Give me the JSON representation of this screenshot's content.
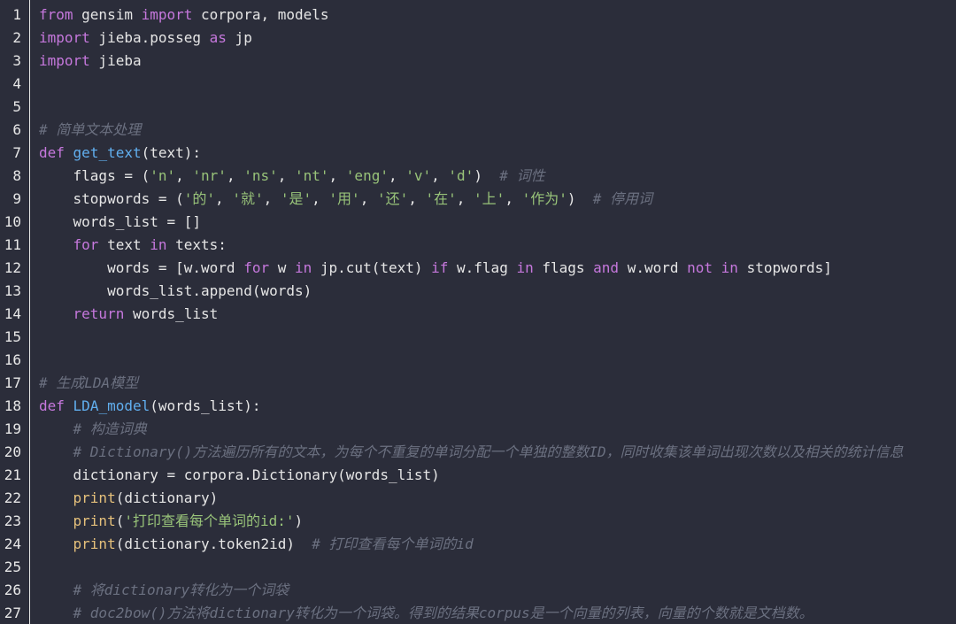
{
  "editor": {
    "colors": {
      "background": "#2b2d3a",
      "text": "#e6e6e6",
      "keyword": "#c678dd",
      "function": "#61afef",
      "builtin": "#e5c07b",
      "string": "#98c379",
      "comment": "#6b7080",
      "line_number": "#e8e8e8"
    },
    "lines": [
      {
        "n": "1",
        "tokens": [
          {
            "t": "kw",
            "s": "from"
          },
          {
            "t": "txt",
            "s": " gensim "
          },
          {
            "t": "kw",
            "s": "import"
          },
          {
            "t": "txt",
            "s": " corpora, models"
          }
        ]
      },
      {
        "n": "2",
        "tokens": [
          {
            "t": "kw",
            "s": "import"
          },
          {
            "t": "txt",
            "s": " jieba.posseg "
          },
          {
            "t": "kw",
            "s": "as"
          },
          {
            "t": "txt",
            "s": " jp"
          }
        ]
      },
      {
        "n": "3",
        "tokens": [
          {
            "t": "kw",
            "s": "import"
          },
          {
            "t": "txt",
            "s": " jieba"
          }
        ]
      },
      {
        "n": "4",
        "tokens": []
      },
      {
        "n": "5",
        "tokens": []
      },
      {
        "n": "6",
        "tokens": [
          {
            "t": "cm",
            "s": "# 简单文本处理"
          }
        ]
      },
      {
        "n": "7",
        "tokens": [
          {
            "t": "kw",
            "s": "def"
          },
          {
            "t": "txt",
            "s": " "
          },
          {
            "t": "fn",
            "s": "get_text"
          },
          {
            "t": "txt",
            "s": "(text):"
          }
        ]
      },
      {
        "n": "8",
        "tokens": [
          {
            "t": "txt",
            "s": "    flags = ("
          },
          {
            "t": "str",
            "s": "'n'"
          },
          {
            "t": "txt",
            "s": ", "
          },
          {
            "t": "str",
            "s": "'nr'"
          },
          {
            "t": "txt",
            "s": ", "
          },
          {
            "t": "str",
            "s": "'ns'"
          },
          {
            "t": "txt",
            "s": ", "
          },
          {
            "t": "str",
            "s": "'nt'"
          },
          {
            "t": "txt",
            "s": ", "
          },
          {
            "t": "str",
            "s": "'eng'"
          },
          {
            "t": "txt",
            "s": ", "
          },
          {
            "t": "str",
            "s": "'v'"
          },
          {
            "t": "txt",
            "s": ", "
          },
          {
            "t": "str",
            "s": "'d'"
          },
          {
            "t": "txt",
            "s": ")  "
          },
          {
            "t": "cm",
            "s": "# 词性"
          }
        ]
      },
      {
        "n": "9",
        "tokens": [
          {
            "t": "txt",
            "s": "    stopwords = ("
          },
          {
            "t": "str",
            "s": "'的'"
          },
          {
            "t": "txt",
            "s": ", "
          },
          {
            "t": "str",
            "s": "'就'"
          },
          {
            "t": "txt",
            "s": ", "
          },
          {
            "t": "str",
            "s": "'是'"
          },
          {
            "t": "txt",
            "s": ", "
          },
          {
            "t": "str",
            "s": "'用'"
          },
          {
            "t": "txt",
            "s": ", "
          },
          {
            "t": "str",
            "s": "'还'"
          },
          {
            "t": "txt",
            "s": ", "
          },
          {
            "t": "str",
            "s": "'在'"
          },
          {
            "t": "txt",
            "s": ", "
          },
          {
            "t": "str",
            "s": "'上'"
          },
          {
            "t": "txt",
            "s": ", "
          },
          {
            "t": "str",
            "s": "'作为'"
          },
          {
            "t": "txt",
            "s": ")  "
          },
          {
            "t": "cm",
            "s": "# 停用词"
          }
        ]
      },
      {
        "n": "10",
        "tokens": [
          {
            "t": "txt",
            "s": "    words_list = []"
          }
        ]
      },
      {
        "n": "11",
        "tokens": [
          {
            "t": "txt",
            "s": "    "
          },
          {
            "t": "kw",
            "s": "for"
          },
          {
            "t": "txt",
            "s": " text "
          },
          {
            "t": "kw",
            "s": "in"
          },
          {
            "t": "txt",
            "s": " texts:"
          }
        ]
      },
      {
        "n": "12",
        "tokens": [
          {
            "t": "txt",
            "s": "        words = [w.word "
          },
          {
            "t": "kw",
            "s": "for"
          },
          {
            "t": "txt",
            "s": " w "
          },
          {
            "t": "kw",
            "s": "in"
          },
          {
            "t": "txt",
            "s": " jp.cut(text) "
          },
          {
            "t": "kw",
            "s": "if"
          },
          {
            "t": "txt",
            "s": " w.flag "
          },
          {
            "t": "kw",
            "s": "in"
          },
          {
            "t": "txt",
            "s": " flags "
          },
          {
            "t": "kw",
            "s": "and"
          },
          {
            "t": "txt",
            "s": " w.word "
          },
          {
            "t": "kw",
            "s": "not"
          },
          {
            "t": "txt",
            "s": " "
          },
          {
            "t": "kw",
            "s": "in"
          },
          {
            "t": "txt",
            "s": " stopwords]"
          }
        ]
      },
      {
        "n": "13",
        "tokens": [
          {
            "t": "txt",
            "s": "        words_list.append(words)"
          }
        ]
      },
      {
        "n": "14",
        "tokens": [
          {
            "t": "txt",
            "s": "    "
          },
          {
            "t": "kw",
            "s": "return"
          },
          {
            "t": "txt",
            "s": " words_list"
          }
        ]
      },
      {
        "n": "15",
        "tokens": []
      },
      {
        "n": "16",
        "tokens": []
      },
      {
        "n": "17",
        "tokens": [
          {
            "t": "cm",
            "s": "# 生成LDA模型"
          }
        ]
      },
      {
        "n": "18",
        "tokens": [
          {
            "t": "kw",
            "s": "def"
          },
          {
            "t": "txt",
            "s": " "
          },
          {
            "t": "fn",
            "s": "LDA_model"
          },
          {
            "t": "txt",
            "s": "(words_list):"
          }
        ]
      },
      {
        "n": "19",
        "tokens": [
          {
            "t": "txt",
            "s": "    "
          },
          {
            "t": "cm",
            "s": "# 构造词典"
          }
        ]
      },
      {
        "n": "20",
        "tokens": [
          {
            "t": "txt",
            "s": "    "
          },
          {
            "t": "cm",
            "s": "# Dictionary()方法遍历所有的文本，为每个不重复的单词分配一个单独的整数ID，同时收集该单词出现次数以及相关的统计信息"
          }
        ]
      },
      {
        "n": "21",
        "tokens": [
          {
            "t": "txt",
            "s": "    dictionary = corpora.Dictionary(words_list)"
          }
        ]
      },
      {
        "n": "22",
        "tokens": [
          {
            "t": "txt",
            "s": "    "
          },
          {
            "t": "bi",
            "s": "print"
          },
          {
            "t": "txt",
            "s": "(dictionary)"
          }
        ]
      },
      {
        "n": "23",
        "tokens": [
          {
            "t": "txt",
            "s": "    "
          },
          {
            "t": "bi",
            "s": "print"
          },
          {
            "t": "txt",
            "s": "("
          },
          {
            "t": "str",
            "s": "'打印查看每个单词的id:'"
          },
          {
            "t": "txt",
            "s": ")"
          }
        ]
      },
      {
        "n": "24",
        "tokens": [
          {
            "t": "txt",
            "s": "    "
          },
          {
            "t": "bi",
            "s": "print"
          },
          {
            "t": "txt",
            "s": "(dictionary.token2id)  "
          },
          {
            "t": "cm",
            "s": "# 打印查看每个单词的id"
          }
        ]
      },
      {
        "n": "25",
        "tokens": []
      },
      {
        "n": "26",
        "tokens": [
          {
            "t": "txt",
            "s": "    "
          },
          {
            "t": "cm",
            "s": "# 将dictionary转化为一个词袋"
          }
        ]
      },
      {
        "n": "27",
        "tokens": [
          {
            "t": "txt",
            "s": "    "
          },
          {
            "t": "cm",
            "s": "# doc2bow()方法将dictionary转化为一个词袋。得到的结果corpus是一个向量的列表，向量的个数就是文档数。"
          }
        ]
      }
    ]
  }
}
